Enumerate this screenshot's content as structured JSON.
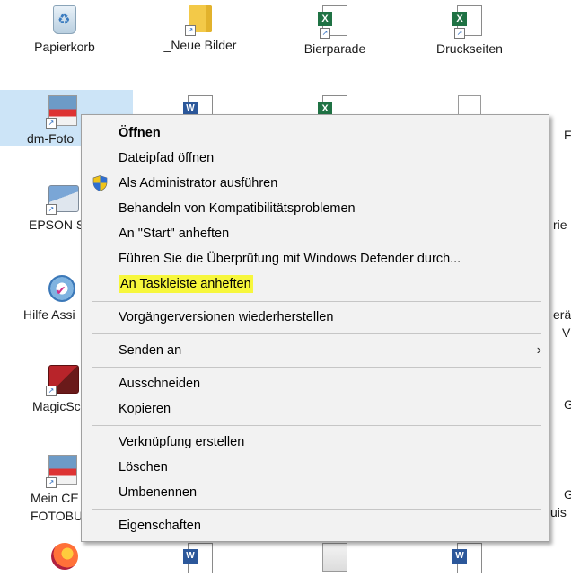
{
  "desktop": {
    "icons": [
      {
        "label": "Papierkorb",
        "icon": "recycle-bin-icon"
      },
      {
        "label": "_Neue Bilder",
        "icon": "folder-icon"
      },
      {
        "label": "Bierparade",
        "icon": "excel-file-icon"
      },
      {
        "label": "Druckseiten",
        "icon": "excel-file-icon"
      },
      {
        "label": "dm-Foto",
        "icon": "photo-app-icon"
      },
      {
        "label": "EPSON S",
        "icon": "scanner-icon"
      },
      {
        "label": "Hilfe Assi",
        "icon": "help-assistant-icon"
      },
      {
        "label": "MagicSc",
        "icon": "magic-app-icon"
      },
      {
        "label": "Mein CE\nFOTOBU",
        "icon": "photobook-icon"
      }
    ],
    "edge_labels": [
      "F",
      "rie",
      "erä",
      "V",
      "G",
      "G",
      "uis"
    ]
  },
  "context_menu": {
    "items": [
      {
        "label": "Öffnen",
        "bold": true
      },
      {
        "label": "Dateipfad öffnen"
      },
      {
        "label": "Als Administrator ausführen",
        "icon": "uac-shield-icon"
      },
      {
        "label": "Behandeln von Kompatibilitätsproblemen"
      },
      {
        "label": "An \"Start\" anheften"
      },
      {
        "label": "Führen Sie die Überprüfung mit Windows Defender durch..."
      },
      {
        "label": "An Taskleiste anheften",
        "highlight": "#f7f73c"
      },
      {
        "label": "Vorgängerversionen wiederherstellen"
      },
      {
        "label": "Senden an",
        "submenu_arrow": "›"
      },
      {
        "label": "Ausschneiden"
      },
      {
        "label": "Kopieren"
      },
      {
        "label": "Verknüpfung erstellen"
      },
      {
        "label": "Löschen"
      },
      {
        "label": "Umbenennen"
      },
      {
        "label": "Eigenschaften"
      }
    ]
  },
  "colors": {
    "selection": "#cce4f7",
    "menu_background": "#f2f2f2",
    "highlighter": "#f7f73c"
  }
}
